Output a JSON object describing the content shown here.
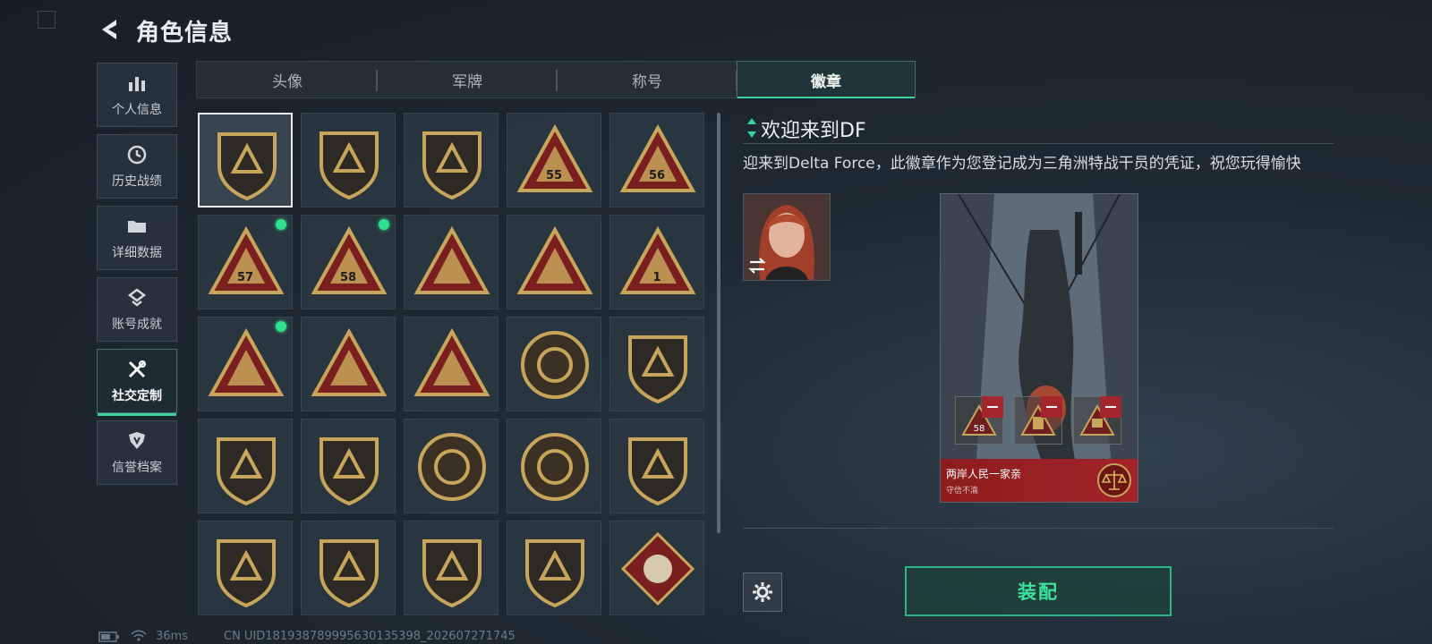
{
  "header": {
    "title": "角色信息",
    "back_icon": "back-arrow-icon"
  },
  "sidebar": {
    "items": [
      {
        "label": "个人信息",
        "icon": "bar-chart-icon"
      },
      {
        "label": "历史战绩",
        "icon": "clock-icon"
      },
      {
        "label": "详细数据",
        "icon": "folder-icon"
      },
      {
        "label": "账号成就",
        "icon": "achievement-icon"
      },
      {
        "label": "社交定制",
        "icon": "tools-icon",
        "active": true
      },
      {
        "label": "信誉档案",
        "icon": "shield-icon"
      }
    ]
  },
  "tabs": [
    {
      "label": "头像"
    },
    {
      "label": "军牌"
    },
    {
      "label": "称号"
    },
    {
      "label": "徽章",
      "active": true
    }
  ],
  "badges": {
    "rows": [
      [
        {
          "name": "badge-df-welcome"
        },
        {
          "name": "badge-helicopter"
        },
        {
          "name": "badge-emblem-dark"
        },
        {
          "name": "badge-season-55",
          "text": "55"
        },
        {
          "name": "badge-season-56",
          "text": "56"
        }
      ],
      [
        {
          "name": "badge-season-57",
          "text": "57",
          "new": true
        },
        {
          "name": "badge-season-58",
          "text": "58",
          "new": true
        },
        {
          "name": "badge-hooded-figure"
        },
        {
          "name": "badge-boat"
        },
        {
          "name": "badge-number-1",
          "text": "1"
        }
      ],
      [
        {
          "name": "badge-usb-drive",
          "new": true
        },
        {
          "name": "badge-soldiers"
        },
        {
          "name": "badge-rocket"
        },
        {
          "name": "badge-star-skull"
        },
        {
          "name": "badge-shield-spade"
        }
      ],
      [
        {
          "name": "badge-red-shield-stars"
        },
        {
          "name": "badge-blue-gem-shield"
        },
        {
          "name": "badge-round-bronze-1"
        },
        {
          "name": "badge-round-bronze-2"
        },
        {
          "name": "badge-green-rifle"
        }
      ],
      [
        {
          "name": "badge-blue-rifle"
        },
        {
          "name": "badge-rifle-shield"
        },
        {
          "name": "badge-pistol-shield"
        },
        {
          "name": "badge-blue-knife"
        },
        {
          "name": "badge-wolf"
        }
      ]
    ]
  },
  "detail": {
    "title": "欢迎来到DF",
    "description": "迎来到Delta Force，此徽章作为您登记成为三角洲特战干员的凭证，祝您玩得愉快",
    "swap_icon": "swap-icon"
  },
  "card": {
    "title": "两岸人民一家亲",
    "subtitle": "守信不渝",
    "slots": [
      {
        "text": "58"
      },
      {
        "text": ""
      },
      {
        "text": ""
      }
    ],
    "emblem_icon": "scales-icon"
  },
  "actions": {
    "equip_label": "装配",
    "settings_icon": "gear-icon"
  },
  "status_bar": {
    "ping": "36ms",
    "uid": "CN UID181938789995630135398_202607271745"
  },
  "colors": {
    "accent": "#38d49a",
    "new_dot": "#2fe08f",
    "danger": "#a2262c",
    "bronze": "#c7a55a",
    "badge_red": "#7a1f1f"
  }
}
